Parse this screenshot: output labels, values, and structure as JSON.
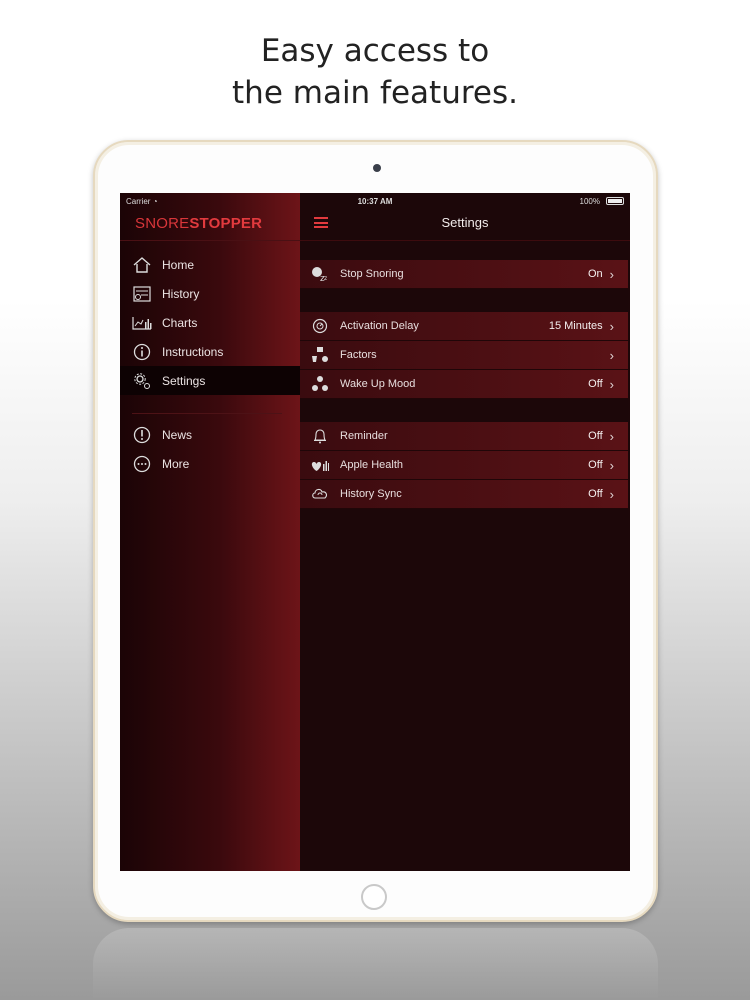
{
  "headline": {
    "line1": "Easy access to",
    "line2": "the main features."
  },
  "statusbar": {
    "carrier": "Carrier",
    "time": "10:37 AM",
    "battery": "100%"
  },
  "brand": {
    "part1": "SNORE",
    "part2": "STOPPER"
  },
  "sidebar": {
    "items": [
      {
        "label": "Home",
        "icon": "home-icon"
      },
      {
        "label": "History",
        "icon": "history-icon"
      },
      {
        "label": "Charts",
        "icon": "chart-icon"
      },
      {
        "label": "Instructions",
        "icon": "info-icon"
      },
      {
        "label": "Settings",
        "icon": "gear-icon",
        "active": true
      }
    ],
    "items2": [
      {
        "label": "News",
        "icon": "news-icon"
      },
      {
        "label": "More",
        "icon": "more-icon"
      }
    ]
  },
  "main": {
    "title": "Settings",
    "groups": [
      [
        {
          "label": "Stop Snoring",
          "value": "On",
          "icon": "snore-icon"
        }
      ],
      [
        {
          "label": "Activation Delay",
          "value": "15 Minutes",
          "icon": "timer-icon"
        },
        {
          "label": "Factors",
          "value": "",
          "icon": "factors-icon"
        },
        {
          "label": "Wake Up Mood",
          "value": "Off",
          "icon": "mood-icon"
        }
      ],
      [
        {
          "label": "Reminder",
          "value": "Off",
          "icon": "bell-icon"
        },
        {
          "label": "Apple Health",
          "value": "Off",
          "icon": "health-icon"
        },
        {
          "label": "History Sync",
          "value": "Off",
          "icon": "sync-icon"
        }
      ]
    ]
  },
  "colors": {
    "accent": "#e23a3e",
    "background": "#1c0709"
  }
}
